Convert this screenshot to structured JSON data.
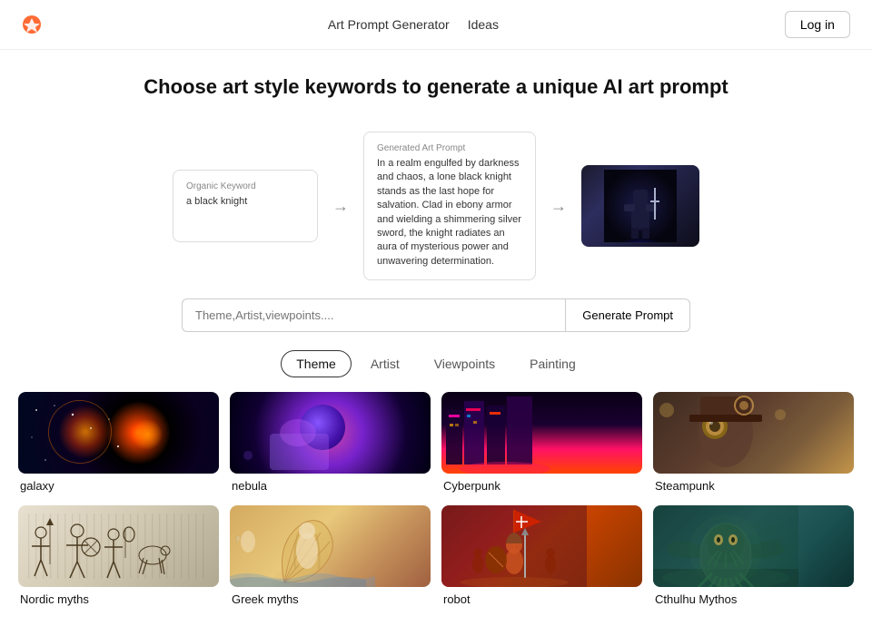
{
  "header": {
    "nav": [
      {
        "label": "Art Prompt Generator",
        "id": "art-prompt-generator"
      },
      {
        "label": "Ideas",
        "id": "ideas"
      }
    ],
    "login_label": "Log in"
  },
  "hero": {
    "title": "Choose art style keywords to generate a unique AI art prompt"
  },
  "flow": {
    "input_label": "Organic Keyword",
    "input_value": "a black knight",
    "output_label": "Generated Art Prompt",
    "output_text": "In a realm engulfed by darkness and chaos, a lone black knight stands as the last hope for salvation. Clad in ebony armor and wielding a shimmering silver sword, the knight radiates an aura of mysterious power and unwavering determination."
  },
  "search": {
    "placeholder": "Theme,Artist,viewpoints....",
    "generate_label": "Generate Prompt"
  },
  "tabs": [
    {
      "label": "Theme",
      "active": true
    },
    {
      "label": "Artist",
      "active": false
    },
    {
      "label": "Viewpoints",
      "active": false
    },
    {
      "label": "Painting",
      "active": false
    }
  ],
  "grid": {
    "items": [
      {
        "label": "galaxy",
        "img_class": "img-galaxy"
      },
      {
        "label": "nebula",
        "img_class": "img-nebula"
      },
      {
        "label": "Cyberpunk",
        "img_class": "img-cyberpunk"
      },
      {
        "label": "Steampunk",
        "img_class": "img-steampunk"
      },
      {
        "label": "Nordic myths",
        "img_class": "img-nordic"
      },
      {
        "label": "Greek myths",
        "img_class": "img-greek"
      },
      {
        "label": "robot",
        "img_class": "img-robot"
      },
      {
        "label": "Cthulhu Mythos",
        "img_class": "img-cthulhu"
      }
    ]
  }
}
